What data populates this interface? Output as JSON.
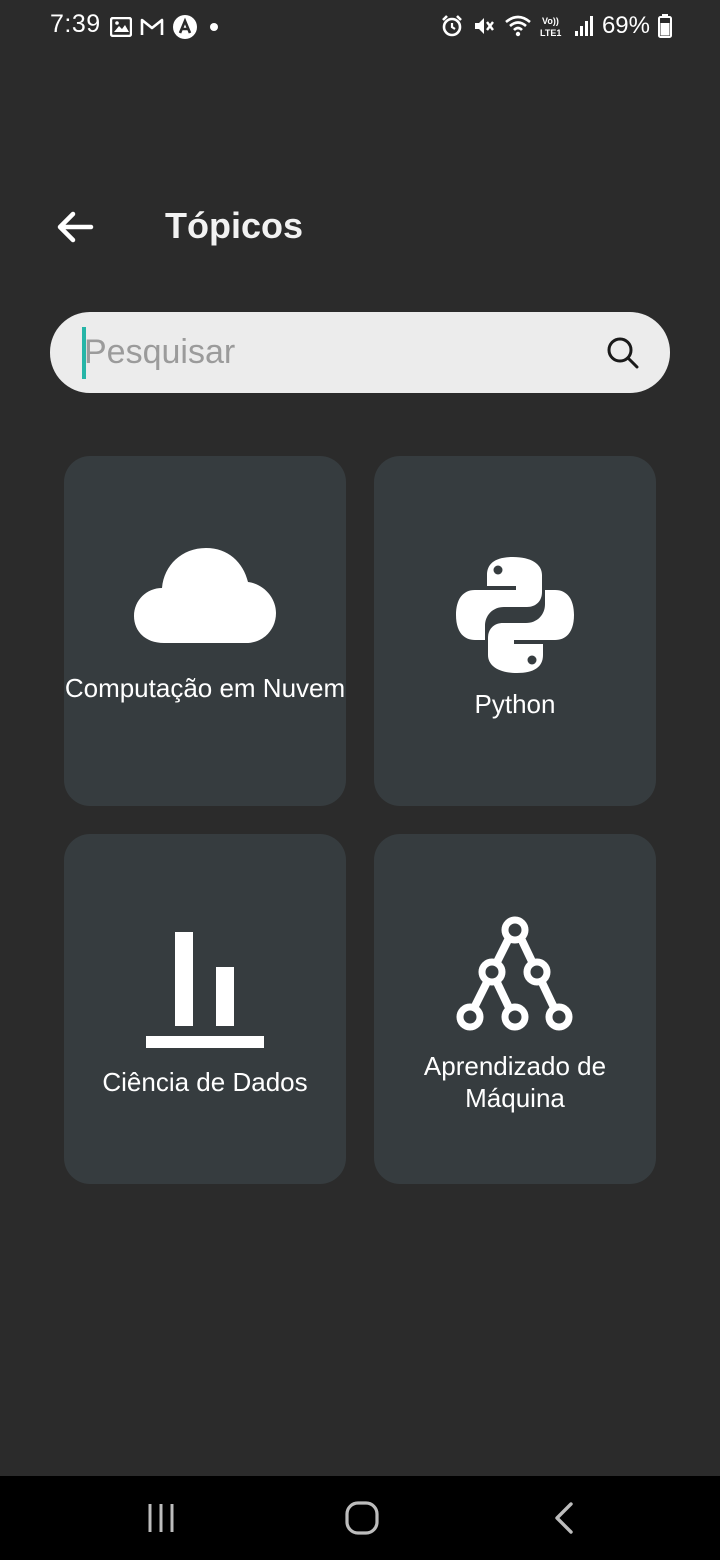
{
  "status_bar": {
    "time": "7:39",
    "battery_percent": "69%",
    "left_icons": [
      "image-icon",
      "gmail-icon",
      "app-notification-icon",
      "dot-icon"
    ],
    "right_icons": [
      "alarm-icon",
      "mute-icon",
      "wifi-icon",
      "volte-icon",
      "signal-icon",
      "battery-icon"
    ]
  },
  "header": {
    "title": "Tópicos"
  },
  "search": {
    "placeholder": "Pesquisar",
    "value": ""
  },
  "topics": [
    {
      "label": "Computação em Nuvem",
      "icon": "cloud-icon"
    },
    {
      "label": "Python",
      "icon": "python-icon"
    },
    {
      "label": "Ciência de Dados",
      "icon": "bar-chart-icon"
    },
    {
      "label": "Aprendizado de Máquina",
      "icon": "tree-network-icon"
    }
  ],
  "nav_bar": {
    "items": [
      "recents-icon",
      "home-icon",
      "back-nav-icon"
    ]
  },
  "colors": {
    "background": "#2b2b2b",
    "card": "#363c3f",
    "search_bg": "#ececec",
    "caret": "#26b5a7",
    "nav_bar": "#000000"
  }
}
